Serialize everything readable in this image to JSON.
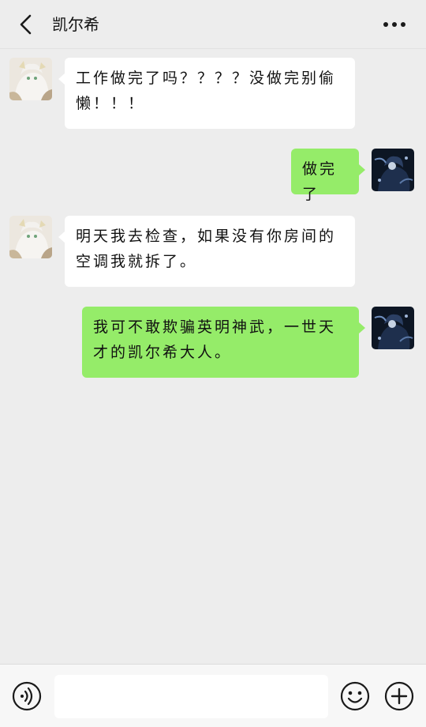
{
  "header": {
    "title": "凯尔希",
    "back_icon": "chevron-left-icon",
    "more_icon": "more-horizontal-icon"
  },
  "messages": [
    {
      "side": "in",
      "sender": "凯尔希",
      "text": "工作做完了吗？？？？没做完别偷懒！！！"
    },
    {
      "side": "out",
      "sender": "me",
      "text": "做完了"
    },
    {
      "side": "in",
      "sender": "凯尔希",
      "text": "明天我去检查，如果没有你房间的空调我就拆了。"
    },
    {
      "side": "out",
      "sender": "me",
      "text": "我可不敢欺骗英明神武，一世天才的凯尔希大人。"
    }
  ],
  "input_bar": {
    "voice_icon": "voice-icon",
    "input_value": "",
    "input_placeholder": "",
    "emoji_icon": "emoji-icon",
    "plus_icon": "plus-circle-icon"
  },
  "colors": {
    "background": "#ededed",
    "incoming_bubble": "#ffffff",
    "outgoing_bubble": "#95ec69",
    "input_bar": "#f7f7f7"
  }
}
